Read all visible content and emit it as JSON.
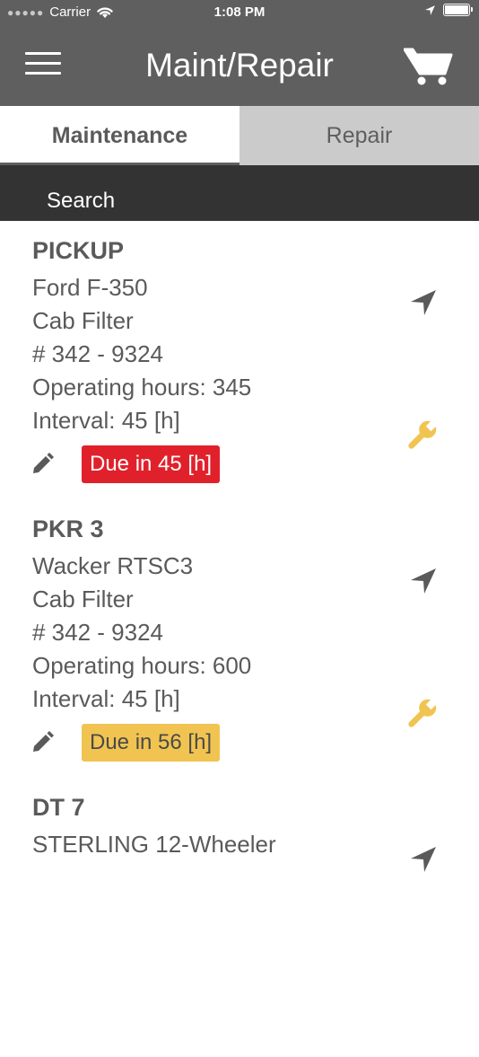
{
  "status_bar": {
    "carrier": "Carrier",
    "time": "1:08 PM"
  },
  "header": {
    "title": "Maint/Repair"
  },
  "tabs": [
    {
      "label": "Maintenance",
      "active": true
    },
    {
      "label": "Repair",
      "active": false
    }
  ],
  "search": {
    "placeholder": "Search"
  },
  "cards": [
    {
      "name": "PICKUP",
      "model": "Ford F-350",
      "part": "Cab Filter",
      "part_number": "# 342 - 9324",
      "hours": "Operating hours: 345",
      "interval": "Interval: 45 [h]",
      "due": "Due in 45 [h]",
      "due_color": "#e0212b"
    },
    {
      "name": "PKR 3",
      "model": "Wacker RTSC3",
      "part": "Cab Filter",
      "part_number": "# 342 - 9324",
      "hours": "Operating hours: 600",
      "interval": "Interval: 45 [h]",
      "due": "Due in 56 [h]",
      "due_color": "#f1c451"
    },
    {
      "name": "DT 7",
      "model": "STERLING 12-Wheeler"
    }
  ],
  "colors": {
    "header_bg": "#5f5f5f",
    "search_bg": "#333333",
    "wrench": "#f1c451",
    "icon_gray": "#5a5a5a"
  },
  "icons": [
    "menu-icon",
    "cart-icon",
    "wifi-icon",
    "location-icon",
    "battery-icon",
    "navigation-arrow-icon",
    "wrench-icon",
    "pencil-icon"
  ]
}
